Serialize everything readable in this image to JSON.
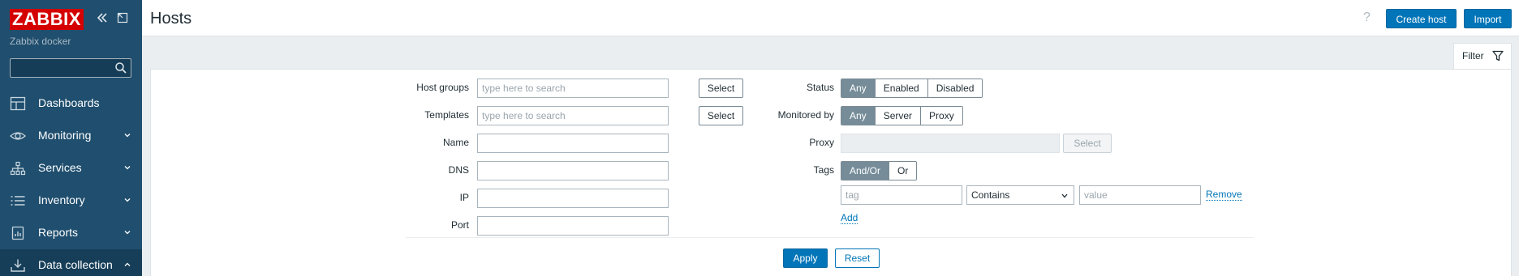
{
  "sidebar": {
    "logo": "ZABBIX",
    "server_name": "Zabbix docker",
    "search": {
      "value": "",
      "placeholder": ""
    },
    "items": [
      {
        "label": "Dashboards",
        "icon": "dashboard-icon"
      },
      {
        "label": "Monitoring",
        "icon": "eye-icon"
      },
      {
        "label": "Services",
        "icon": "services-icon"
      },
      {
        "label": "Inventory",
        "icon": "list-icon"
      },
      {
        "label": "Reports",
        "icon": "report-icon"
      },
      {
        "label": "Data collection",
        "icon": "download-icon"
      }
    ]
  },
  "header": {
    "title": "Hosts",
    "help": "?",
    "create_host": "Create host",
    "import": "Import"
  },
  "filter": {
    "tab_label": "Filter",
    "host_groups": {
      "label": "Host groups",
      "placeholder": "type here to search",
      "button": "Select"
    },
    "templates": {
      "label": "Templates",
      "placeholder": "type here to search",
      "button": "Select"
    },
    "name": {
      "label": "Name",
      "value": ""
    },
    "dns": {
      "label": "DNS",
      "value": ""
    },
    "ip": {
      "label": "IP",
      "value": ""
    },
    "port": {
      "label": "Port",
      "value": ""
    },
    "status": {
      "label": "Status",
      "options": [
        "Any",
        "Enabled",
        "Disabled"
      ],
      "selected": "Any"
    },
    "monitored_by": {
      "label": "Monitored by",
      "options": [
        "Any",
        "Server",
        "Proxy"
      ],
      "selected": "Any"
    },
    "proxy": {
      "label": "Proxy",
      "button": "Select"
    },
    "tags": {
      "label": "Tags",
      "options": [
        "And/Or",
        "Or"
      ],
      "selected": "And/Or",
      "tag_placeholder": "tag",
      "operator": "Contains",
      "value_placeholder": "value",
      "remove": "Remove",
      "add": "Add"
    },
    "apply": "Apply",
    "reset": "Reset"
  }
}
